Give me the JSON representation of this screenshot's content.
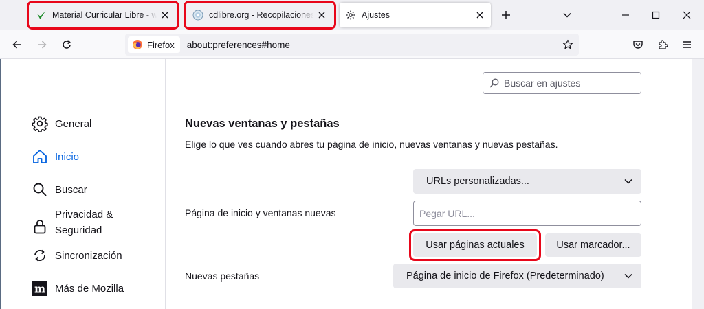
{
  "tabs": [
    {
      "title": "Material Curricular Libre - www.",
      "icon": "green-checkmark-icon",
      "active": false,
      "highlighted": true
    },
    {
      "title": "cdlibre.org - Recopilaciones de",
      "icon": "cd-disc-icon",
      "active": false,
      "highlighted": true
    },
    {
      "title": "Ajustes",
      "icon": "gear-icon",
      "active": true,
      "highlighted": false
    }
  ],
  "toolbar": {
    "identity_label": "Firefox",
    "url": "about:preferences#home"
  },
  "search": {
    "placeholder": "Buscar en ajustes"
  },
  "sidebar": {
    "items": [
      {
        "label": "General",
        "icon": "gear-icon",
        "selected": false
      },
      {
        "label": "Inicio",
        "icon": "home-icon",
        "selected": true
      },
      {
        "label": "Buscar",
        "icon": "search-icon",
        "selected": false
      },
      {
        "label_line1": "Privacidad &",
        "label_line2": "Seguridad",
        "icon": "lock-icon",
        "selected": false
      },
      {
        "label": "Sincronización",
        "icon": "sync-icon",
        "selected": false
      },
      {
        "label": "Más de Mozilla",
        "icon": "mozilla-m-icon",
        "selected": false
      }
    ]
  },
  "main": {
    "section_title": "Nuevas ventanas y pestañas",
    "section_desc": "Elige lo que ves cuando abres tu página de inicio, nuevas ventanas y nuevas pestañas.",
    "homepage": {
      "label": "Página de inicio y ventanas nuevas",
      "mode_value": "URLs personalizadas...",
      "url_placeholder": "Pegar URL...",
      "use_current_pre": "Usar páginas a",
      "use_current_key": "c",
      "use_current_post": "tuales",
      "use_bookmark_pre": "Usar ",
      "use_bookmark_key": "m",
      "use_bookmark_post": "arcador..."
    },
    "newtabs": {
      "label": "Nuevas pestañas",
      "value": "Página de inicio de Firefox (Predeterminado)"
    }
  },
  "colors": {
    "highlight": "#e8061a",
    "accent": "#0061e0",
    "button_bg": "#e9e9ed",
    "tabstrip_bg": "#f0f0f4"
  }
}
